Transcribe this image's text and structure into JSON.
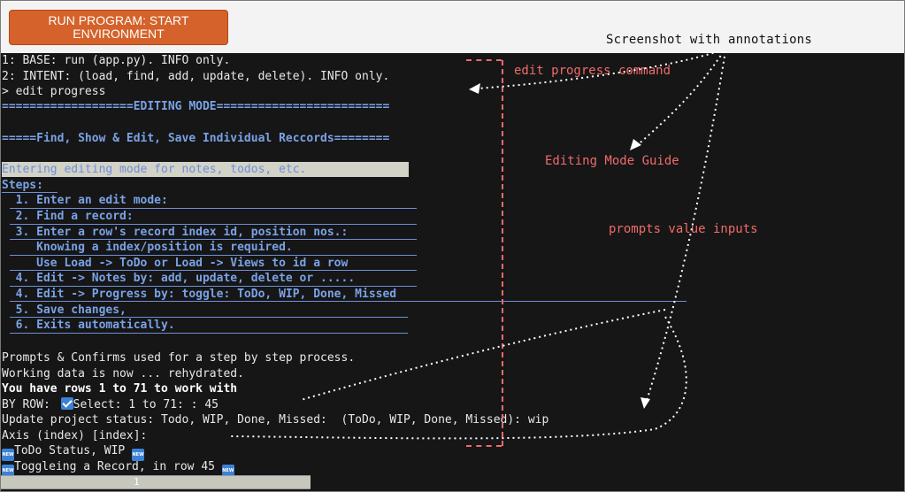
{
  "toolbar": {
    "run_label": "RUN PROGRAM: START ENVIRONMENT"
  },
  "annotations": {
    "title": "Screenshot with annotations",
    "edit_progress": "edit progress command",
    "editing_guide": "Editing Mode Guide",
    "prompts": "prompts value inputs"
  },
  "console": {
    "lines": [
      "1: BASE: run (app.py). INFO only.",
      "2: INTENT: (load, find, add, update, delete). INFO only.",
      "> edit progress",
      "===================EDITING MODE=========================",
      "=====Find, Show & Edit, Save Individual Reccords========",
      "Entering editing mode for notes, todos, etc.",
      "Steps:",
      "  1. Enter an edit mode:",
      "  2. Find a record:",
      "  3. Enter a row's record index id, position nos.:",
      "     Knowing a index/position is required.",
      "     Use Load -> ToDo or Load -> Views to id a row",
      "  4. Edit -> Notes by: add, update, delete or .....",
      "  4. Edit -> Progress by: toggle: ToDo, WIP, Done, Missed",
      "  5. Save changes,",
      "  6. Exits automatically.",
      "Prompts & Confirms used for a step by step process.",
      "Working data is now ... rehydrated.",
      "You have rows 1 to 71 to work with",
      "BY ROW: ",
      "Select: 1 to 71: : 45",
      "Update project status: Todo, WIP, Done, Missed:  (ToDo, WIP, Done, Missed): wip",
      "Axis (index) [index]:",
      "ToDo Status, WIP ",
      "Toggleing a Record, in row 45 "
    ]
  },
  "scrollbar": {
    "label": "1"
  },
  "colors": {
    "accent": "#d4622a",
    "annotation": "#f06a6a",
    "console_bg": "#161616",
    "console_blue": "#7aa2e6"
  }
}
